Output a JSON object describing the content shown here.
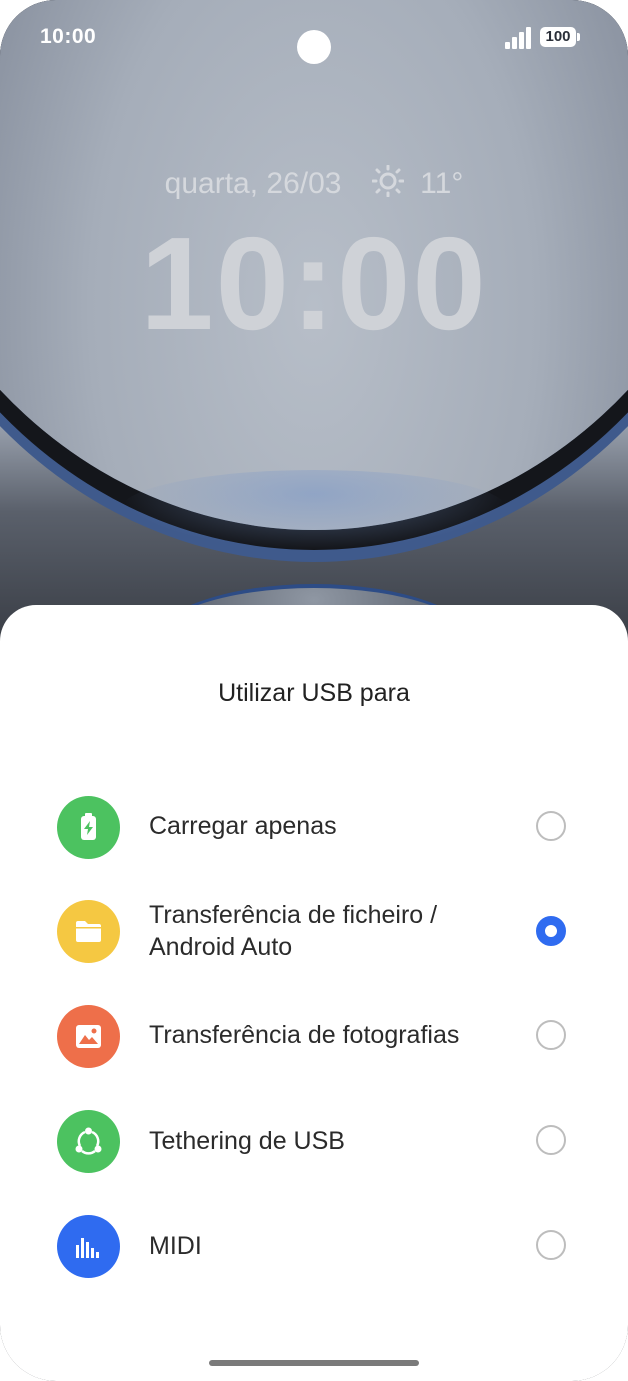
{
  "status_bar": {
    "time": "10:00",
    "battery": "100"
  },
  "lockscreen": {
    "date": "quarta, 26/03",
    "weather_icon": "sun-icon",
    "temperature": "11°",
    "clock": "10:00"
  },
  "usb_sheet": {
    "title": "Utilizar USB para",
    "options": [
      {
        "label": "Carregar apenas",
        "icon": "battery-charge-icon",
        "color": "#4cc260",
        "selected": false
      },
      {
        "label": "Transferência de ficheiro / Android Auto",
        "icon": "folder-icon",
        "color": "#f5c842",
        "selected": true
      },
      {
        "label": "Transferência de fotografias",
        "icon": "image-icon",
        "color": "#ee6f4a",
        "selected": false
      },
      {
        "label": "Tethering de USB",
        "icon": "share-network-icon",
        "color": "#4cc260",
        "selected": false
      },
      {
        "label": "MIDI",
        "icon": "equalizer-icon",
        "color": "#2f6bf0",
        "selected": false
      }
    ],
    "accent_color": "#2f6bf0"
  }
}
